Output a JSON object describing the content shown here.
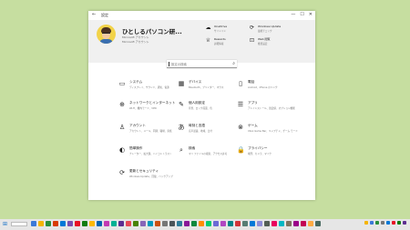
{
  "window": {
    "back_glyph": "←",
    "title": "設定",
    "min_glyph": "—",
    "max_glyph": "☐",
    "close_glyph": "✕"
  },
  "account": {
    "name": "ひとしるパソコン研...",
    "line1": "Microsoft アカウント",
    "line2": "Microsoft アカウント"
  },
  "quick_links": [
    {
      "title": "OneDrive",
      "sub": "サインイン",
      "icon": "cloud-icon",
      "glyph": "☁"
    },
    {
      "title": "Windows Update",
      "sub": "最終チェック",
      "icon": "update-icon",
      "glyph": "⟳"
    },
    {
      "title": "Rewards",
      "sub": "詳細情報",
      "icon": "trophy-icon",
      "glyph": "♕"
    },
    {
      "title": "Web 閲覧",
      "sub": "推奨設定",
      "icon": "web-icon",
      "glyph": "⊡"
    }
  ],
  "search": {
    "placeholder": "設定の検索",
    "icon": "search-icon",
    "glyph": "⌕"
  },
  "categories": [
    {
      "title": "システム",
      "sub": "ディスプレイ、サウンド、通知、電源",
      "icon": "laptop-icon",
      "glyph": "▭"
    },
    {
      "title": "デバイス",
      "sub": "Bluetooth、プリンター、マウス",
      "icon": "keyboard-icon",
      "glyph": "▦"
    },
    {
      "title": "電話",
      "sub": "Android、iPhone のリンク",
      "icon": "phone-icon",
      "glyph": "▯"
    },
    {
      "title": "ネットワークとインターネット",
      "sub": "Wi-Fi、機内モード、VPN",
      "icon": "globe-icon",
      "glyph": "⊕"
    },
    {
      "title": "個人用設定",
      "sub": "背景、ロック画面、色",
      "icon": "brush-icon",
      "glyph": "✎"
    },
    {
      "title": "アプリ",
      "sub": "アンインストール、既定値、オプション機能",
      "icon": "apps-icon",
      "glyph": "☰"
    },
    {
      "title": "アカウント",
      "sub": "アカウント、メール、同期、職場、家族",
      "icon": "person-icon",
      "glyph": "♙"
    },
    {
      "title": "時刻と言語",
      "sub": "音声認識、地域、日付",
      "icon": "time-language-icon",
      "glyph": "あ"
    },
    {
      "title": "ゲーム",
      "sub": "Xbox Game Bar、キャプチャ、ゲーム モード",
      "icon": "gaming-icon",
      "glyph": "⊗"
    },
    {
      "title": "簡単操作",
      "sub": "ナレーター、拡大鏡、ハイコントラスト",
      "icon": "accessibility-icon",
      "glyph": "◐"
    },
    {
      "title": "検索",
      "sub": "マイ ファイルの検索、アクセス許可",
      "icon": "search-category-icon",
      "glyph": "⌕"
    },
    {
      "title": "プライバシー",
      "sub": "場所、カメラ、マイク",
      "icon": "lock-icon",
      "glyph": "🔒"
    },
    {
      "title": "更新とセキュリティ",
      "sub": "Windows Update、回復、バックアップ",
      "icon": "refresh-icon",
      "glyph": "⟳"
    }
  ],
  "taskbar": {
    "start_glyph": "⊞",
    "app_colors": [
      "#3b78d8",
      "#f5b400",
      "#2a8f3a",
      "#d83b01",
      "#0078d7",
      "#7a4fb0",
      "#e81123",
      "#107c10",
      "#ffb900",
      "#0063b1",
      "#c239b3",
      "#00b294",
      "#5c2d91",
      "#e74856",
      "#498205",
      "#8764b8",
      "#0099bc",
      "#ca5010",
      "#767676",
      "#4a5459",
      "#2d7d9a",
      "#881798",
      "#10893e",
      "#ff8c00",
      "#00cc6a",
      "#6b69d6",
      "#b146c2",
      "#038387",
      "#d13438",
      "#567c73",
      "#0078d7",
      "#8e8cd8",
      "#525e54",
      "#ea005e",
      "#00b7c3",
      "#7e735f",
      "#9a0089",
      "#c30052",
      "#ffaa44",
      "#486860"
    ],
    "tray_colors": [
      "#f5b400",
      "#3b78d8",
      "#2a8f3a",
      "#767676",
      "#0078d7",
      "#e81123",
      "#107c10",
      "#5c2d91"
    ],
    "clock_time": "",
    "clock_date": ""
  }
}
